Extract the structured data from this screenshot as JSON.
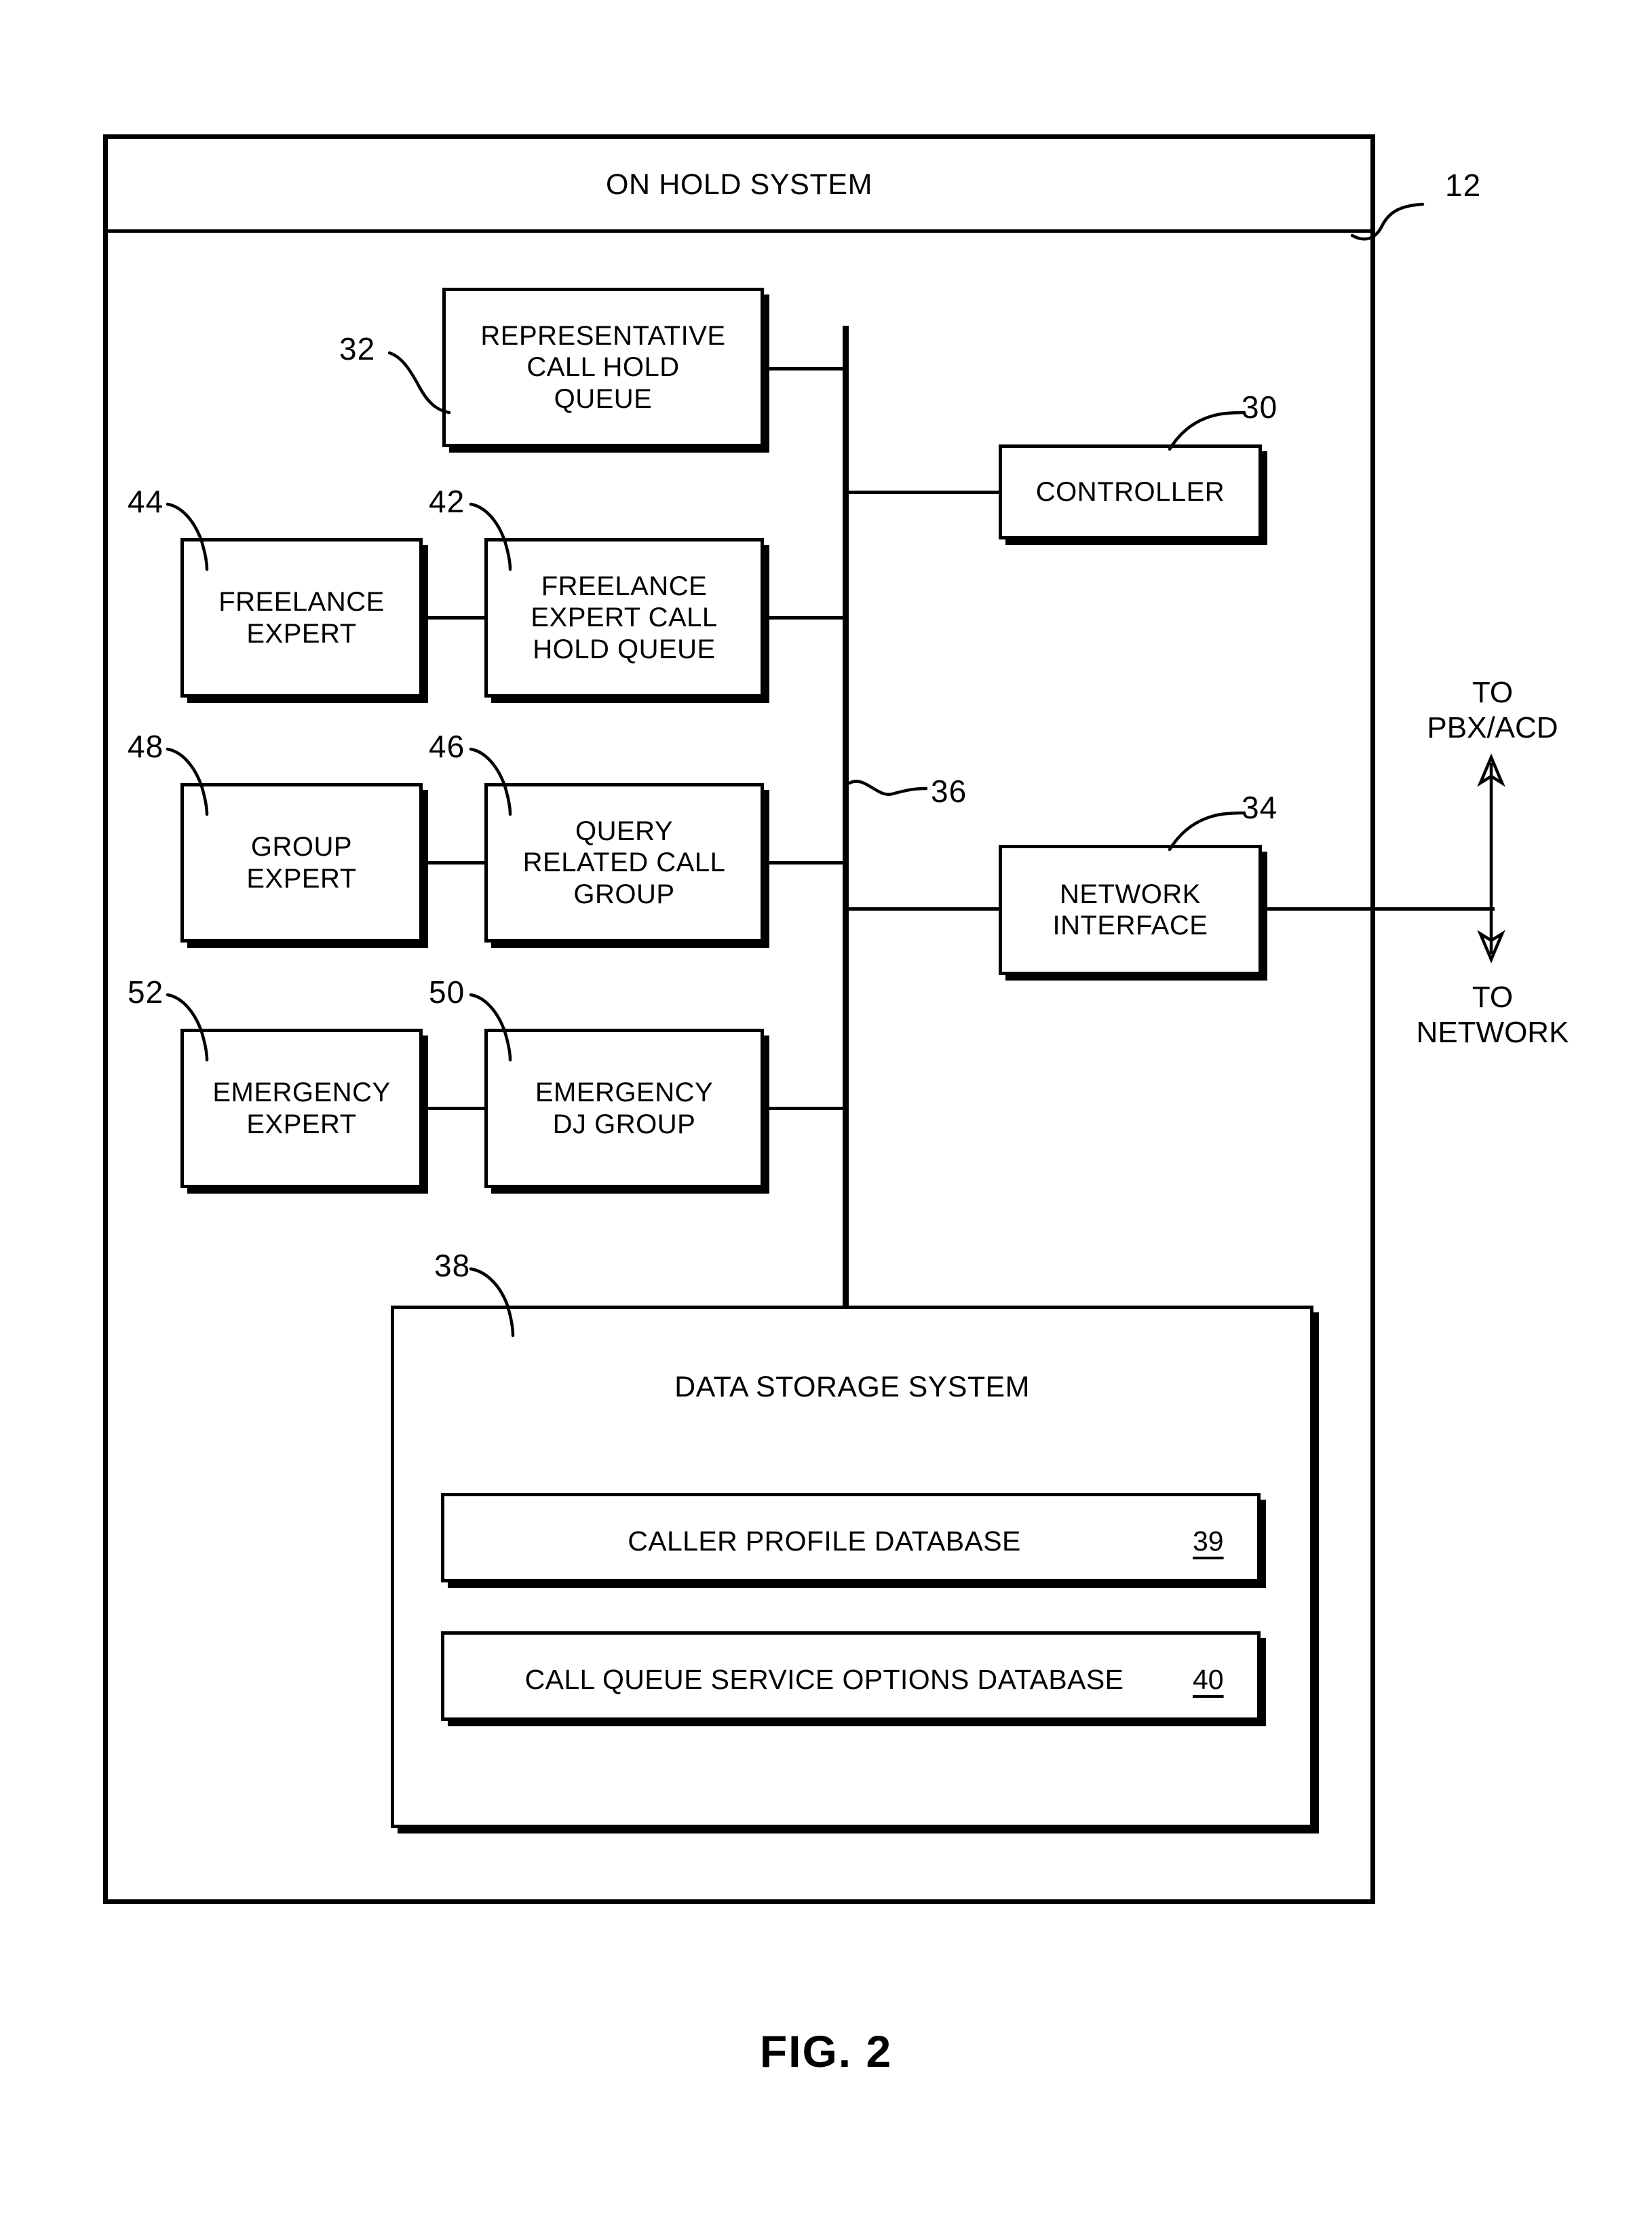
{
  "figure": {
    "caption": "FIG. 2",
    "outer_system_title": "ON HOLD SYSTEM",
    "outer_system_ref": "12"
  },
  "blocks": [
    {
      "id": "representative-call-hold-queue",
      "label": "REPRESENTATIVE\nCALL HOLD\nQUEUE",
      "ref": "32"
    },
    {
      "id": "controller",
      "label": "CONTROLLER",
      "ref": "30"
    },
    {
      "id": "freelance-expert",
      "label": "FREELANCE\nEXPERT",
      "ref": "44"
    },
    {
      "id": "freelance-expert-call-hold-queue",
      "label": "FREELANCE\nEXPERT CALL\nHOLD QUEUE",
      "ref": "42"
    },
    {
      "id": "group-expert",
      "label": "GROUP\nEXPERT",
      "ref": "48"
    },
    {
      "id": "query-related-call-group",
      "label": "QUERY\nRELATED CALL\nGROUP",
      "ref": "46"
    },
    {
      "id": "emergency-expert",
      "label": "EMERGENCY\nEXPERT",
      "ref": "52"
    },
    {
      "id": "emergency-dj-group",
      "label": "EMERGENCY\nDJ GROUP",
      "ref": "50"
    },
    {
      "id": "network-interface",
      "label": "NETWORK\nINTERFACE",
      "ref": "34"
    }
  ],
  "bus": {
    "ref": "36"
  },
  "data_storage": {
    "title": "DATA STORAGE SYSTEM",
    "ref": "38",
    "databases": [
      {
        "label": "CALLER PROFILE DATABASE",
        "ref": "39"
      },
      {
        "label": "CALL QUEUE SERVICE OPTIONS DATABASE",
        "ref": "40"
      }
    ]
  },
  "external_connections": [
    {
      "id": "to-pbx-acd",
      "label": "TO\nPBX/ACD"
    },
    {
      "id": "to-network",
      "label": "TO\nNETWORK"
    }
  ]
}
